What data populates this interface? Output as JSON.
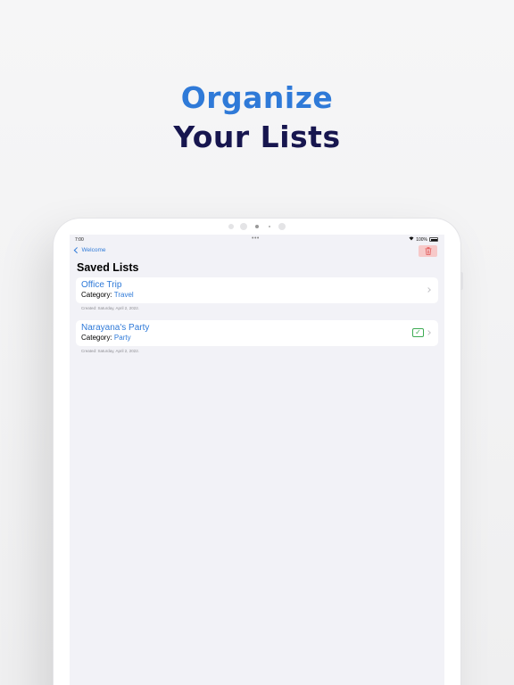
{
  "promo": {
    "line1": "Organize",
    "line2": "Your Lists"
  },
  "status_bar": {
    "time": "7:00",
    "dots": "•••",
    "battery": "100%"
  },
  "nav": {
    "back_label": "Welcome",
    "trash_icon": "trash-icon"
  },
  "screen_title": "Saved Lists",
  "category_label": "Category: ",
  "lists": [
    {
      "name": "Office Trip",
      "category": "Travel",
      "created": "Created: Saturday, April 2, 2022.",
      "completed": false
    },
    {
      "name": "Narayana's Party",
      "category": "Party",
      "created": "Created: Saturday, April 2, 2022.",
      "completed": true,
      "badge_icon": "checkmark-icon"
    }
  ],
  "colors": {
    "accent": "#2f7ad8",
    "headline_dark": "#17164f",
    "success": "#3dab53",
    "danger_bg": "#f7c9c9",
    "danger": "#e05555"
  }
}
